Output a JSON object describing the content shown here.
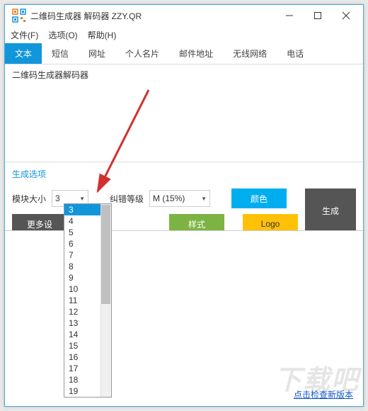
{
  "title": "二维码生成器 解码器 ZZY.QR",
  "menu": {
    "file": "文件(F)",
    "options": "选项(O)",
    "help": "帮助(H)"
  },
  "tabs": [
    "文本",
    "短信",
    "网址",
    "个人名片",
    "邮件地址",
    "无线网络",
    "电话"
  ],
  "contentText": "二维码生成器解码器",
  "genSection": {
    "title": "生成选项",
    "moduleSizeLabel": "模块大小",
    "moduleSizeValue": "3",
    "errorLevelLabel": "纠错等级",
    "errorLevelValue": "M (15%)",
    "colorBtn": "颜色",
    "generateBtn": "生成",
    "styleBtn": "样式",
    "logoBtn": "Logo",
    "moreBtn": "更多设"
  },
  "dropdownOptions": [
    "3",
    "4",
    "5",
    "6",
    "7",
    "8",
    "9",
    "10",
    "11",
    "12",
    "13",
    "14",
    "15",
    "16",
    "17",
    "18",
    "19"
  ],
  "dropdownSelected": "3",
  "footerLink": "点击检查新版本",
  "watermark": "下载吧"
}
